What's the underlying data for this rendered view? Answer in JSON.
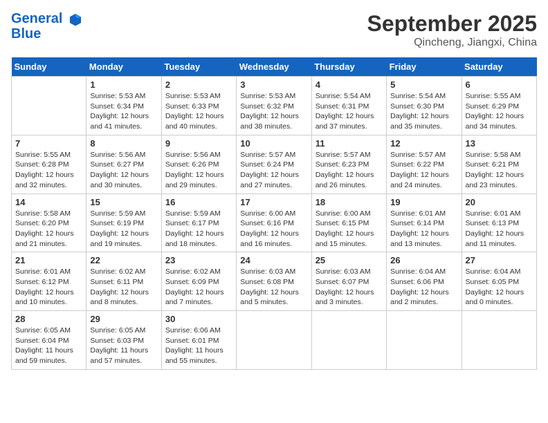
{
  "logo": {
    "line1": "General",
    "line2": "Blue"
  },
  "title": "September 2025",
  "subtitle": "Qincheng, Jiangxi, China",
  "days_of_week": [
    "Sunday",
    "Monday",
    "Tuesday",
    "Wednesday",
    "Thursday",
    "Friday",
    "Saturday"
  ],
  "weeks": [
    [
      {
        "day": "",
        "info": ""
      },
      {
        "day": "1",
        "info": "Sunrise: 5:53 AM\nSunset: 6:34 PM\nDaylight: 12 hours\nand 41 minutes."
      },
      {
        "day": "2",
        "info": "Sunrise: 5:53 AM\nSunset: 6:33 PM\nDaylight: 12 hours\nand 40 minutes."
      },
      {
        "day": "3",
        "info": "Sunrise: 5:53 AM\nSunset: 6:32 PM\nDaylight: 12 hours\nand 38 minutes."
      },
      {
        "day": "4",
        "info": "Sunrise: 5:54 AM\nSunset: 6:31 PM\nDaylight: 12 hours\nand 37 minutes."
      },
      {
        "day": "5",
        "info": "Sunrise: 5:54 AM\nSunset: 6:30 PM\nDaylight: 12 hours\nand 35 minutes."
      },
      {
        "day": "6",
        "info": "Sunrise: 5:55 AM\nSunset: 6:29 PM\nDaylight: 12 hours\nand 34 minutes."
      }
    ],
    [
      {
        "day": "7",
        "info": "Sunrise: 5:55 AM\nSunset: 6:28 PM\nDaylight: 12 hours\nand 32 minutes."
      },
      {
        "day": "8",
        "info": "Sunrise: 5:56 AM\nSunset: 6:27 PM\nDaylight: 12 hours\nand 30 minutes."
      },
      {
        "day": "9",
        "info": "Sunrise: 5:56 AM\nSunset: 6:26 PM\nDaylight: 12 hours\nand 29 minutes."
      },
      {
        "day": "10",
        "info": "Sunrise: 5:57 AM\nSunset: 6:24 PM\nDaylight: 12 hours\nand 27 minutes."
      },
      {
        "day": "11",
        "info": "Sunrise: 5:57 AM\nSunset: 6:23 PM\nDaylight: 12 hours\nand 26 minutes."
      },
      {
        "day": "12",
        "info": "Sunrise: 5:57 AM\nSunset: 6:22 PM\nDaylight: 12 hours\nand 24 minutes."
      },
      {
        "day": "13",
        "info": "Sunrise: 5:58 AM\nSunset: 6:21 PM\nDaylight: 12 hours\nand 23 minutes."
      }
    ],
    [
      {
        "day": "14",
        "info": "Sunrise: 5:58 AM\nSunset: 6:20 PM\nDaylight: 12 hours\nand 21 minutes."
      },
      {
        "day": "15",
        "info": "Sunrise: 5:59 AM\nSunset: 6:19 PM\nDaylight: 12 hours\nand 19 minutes."
      },
      {
        "day": "16",
        "info": "Sunrise: 5:59 AM\nSunset: 6:17 PM\nDaylight: 12 hours\nand 18 minutes."
      },
      {
        "day": "17",
        "info": "Sunrise: 6:00 AM\nSunset: 6:16 PM\nDaylight: 12 hours\nand 16 minutes."
      },
      {
        "day": "18",
        "info": "Sunrise: 6:00 AM\nSunset: 6:15 PM\nDaylight: 12 hours\nand 15 minutes."
      },
      {
        "day": "19",
        "info": "Sunrise: 6:01 AM\nSunset: 6:14 PM\nDaylight: 12 hours\nand 13 minutes."
      },
      {
        "day": "20",
        "info": "Sunrise: 6:01 AM\nSunset: 6:13 PM\nDaylight: 12 hours\nand 11 minutes."
      }
    ],
    [
      {
        "day": "21",
        "info": "Sunrise: 6:01 AM\nSunset: 6:12 PM\nDaylight: 12 hours\nand 10 minutes."
      },
      {
        "day": "22",
        "info": "Sunrise: 6:02 AM\nSunset: 6:11 PM\nDaylight: 12 hours\nand 8 minutes."
      },
      {
        "day": "23",
        "info": "Sunrise: 6:02 AM\nSunset: 6:09 PM\nDaylight: 12 hours\nand 7 minutes."
      },
      {
        "day": "24",
        "info": "Sunrise: 6:03 AM\nSunset: 6:08 PM\nDaylight: 12 hours\nand 5 minutes."
      },
      {
        "day": "25",
        "info": "Sunrise: 6:03 AM\nSunset: 6:07 PM\nDaylight: 12 hours\nand 3 minutes."
      },
      {
        "day": "26",
        "info": "Sunrise: 6:04 AM\nSunset: 6:06 PM\nDaylight: 12 hours\nand 2 minutes."
      },
      {
        "day": "27",
        "info": "Sunrise: 6:04 AM\nSunset: 6:05 PM\nDaylight: 12 hours\nand 0 minutes."
      }
    ],
    [
      {
        "day": "28",
        "info": "Sunrise: 6:05 AM\nSunset: 6:04 PM\nDaylight: 11 hours\nand 59 minutes."
      },
      {
        "day": "29",
        "info": "Sunrise: 6:05 AM\nSunset: 6:03 PM\nDaylight: 11 hours\nand 57 minutes."
      },
      {
        "day": "30",
        "info": "Sunrise: 6:06 AM\nSunset: 6:01 PM\nDaylight: 11 hours\nand 55 minutes."
      },
      {
        "day": "",
        "info": ""
      },
      {
        "day": "",
        "info": ""
      },
      {
        "day": "",
        "info": ""
      },
      {
        "day": "",
        "info": ""
      }
    ]
  ]
}
